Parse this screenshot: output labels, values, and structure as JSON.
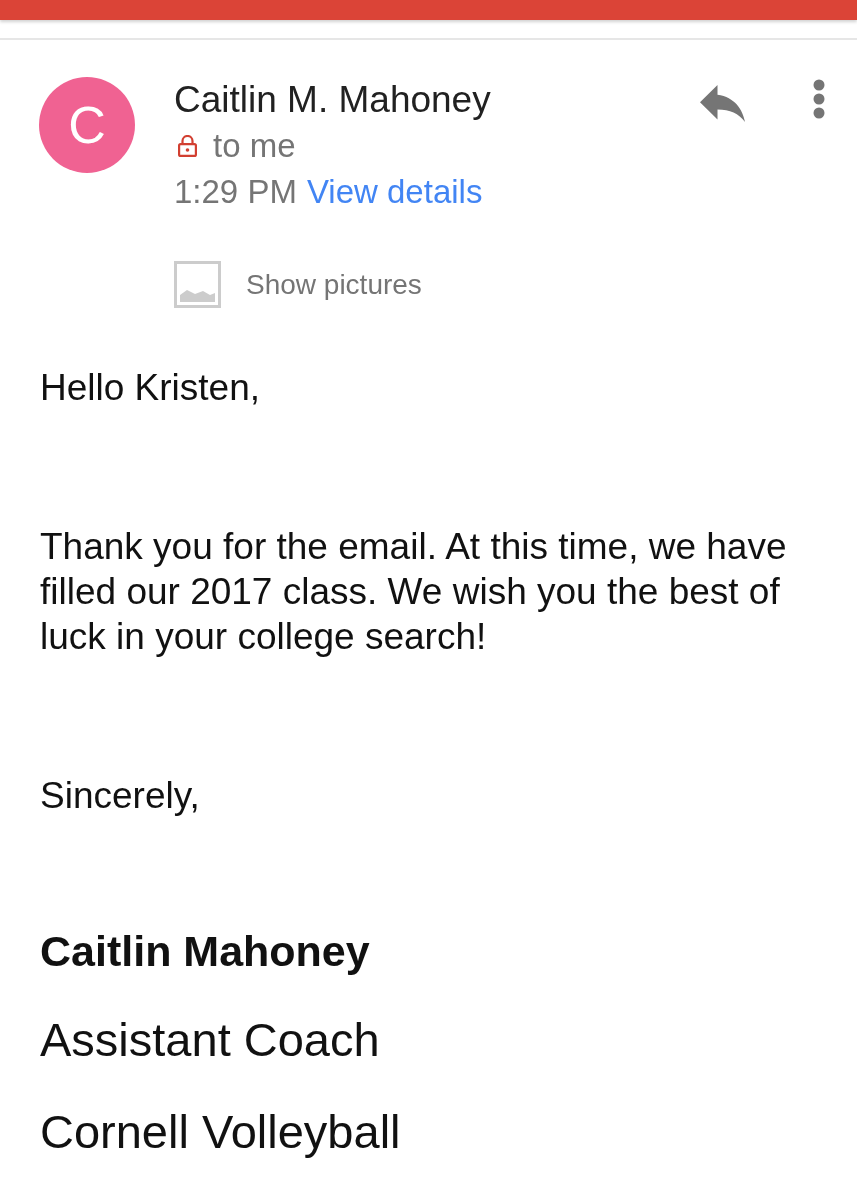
{
  "message_header": {
    "avatar_initial": "C",
    "sender": "Caitlin M. Mahoney",
    "recipient": "to me",
    "time": "1:29 PM",
    "details_link": "View details"
  },
  "images_notice": {
    "label": "Show pictures"
  },
  "body": {
    "paragraphs": [
      "Hello Kristen,",
      "Thank you for the email. At this time, we have filled our 2017 class. We wish you the best of luck in your college search!",
      "Sincerely,"
    ],
    "signature": {
      "name": "Caitlin Mahoney",
      "lines": [
        "Assistant Coach",
        "Cornell Volleyball"
      ]
    }
  }
}
